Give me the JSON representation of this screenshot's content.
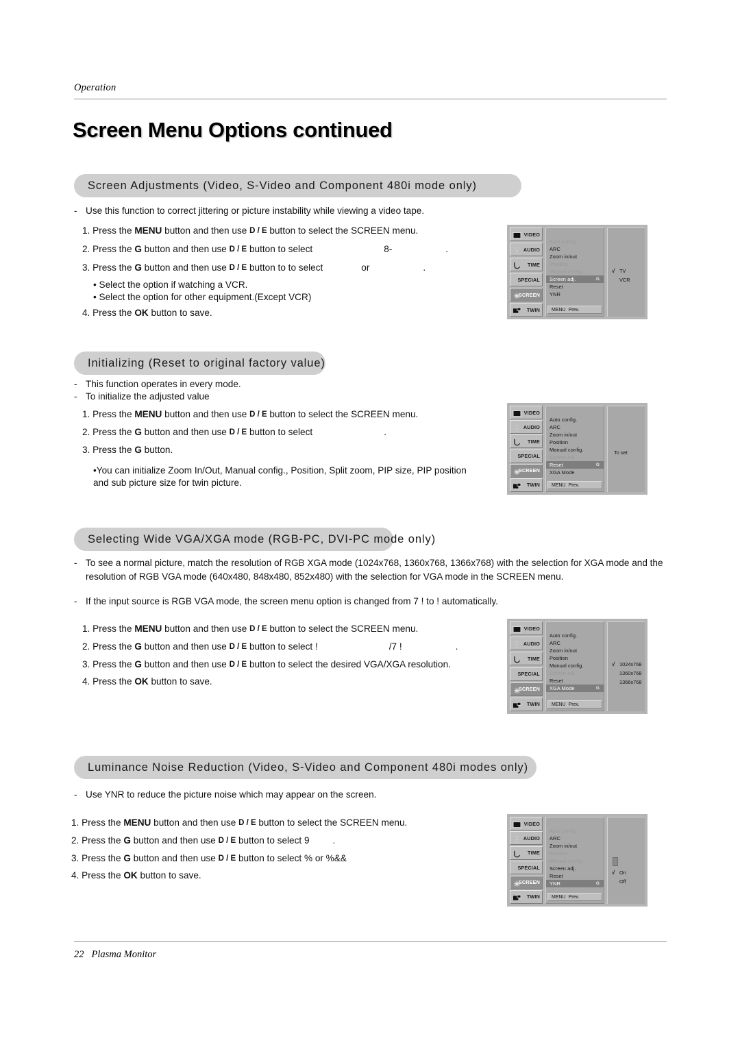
{
  "header": {
    "running_head": "Operation",
    "title": "Screen Menu Options continued"
  },
  "footer": {
    "page_number": "22",
    "product": "Plasma Monitor"
  },
  "sections": [
    {
      "id": "screen-adjustments",
      "heading": "Screen Adjustments (Video, S-Video and Component 480i mode only)",
      "intro": [
        "Use this function to correct jittering or picture instability while viewing a video tape."
      ],
      "steps": [
        {
          "num": "1.",
          "pre": "Press the ",
          "bold": "MENU",
          "mid": " button and then use ",
          "keys": "D / E",
          "post": " button to select the SCREEN menu."
        },
        {
          "num": "2.",
          "pre": "Press the ",
          "bold": "G",
          "mid": " button and then use ",
          "keys": "D / E",
          "post": " button to select",
          "trail": "8-"
        },
        {
          "num": "3.",
          "pre": "Press the ",
          "bold": "G",
          "mid": " button and then use ",
          "keys": "D / E",
          "post": " button to to select",
          "trail": "or"
        }
      ],
      "bullets": [
        "Select the        option if watching a VCR.",
        "Select the        option for other equipment.(Except VCR)"
      ],
      "final_step": {
        "num": "4.",
        "pre": "Press the ",
        "bold": "OK",
        "post": " button to save."
      }
    },
    {
      "id": "initializing",
      "heading": "Initializing (Reset to original factory value)",
      "intro": [
        "This function operates in every mode.",
        "To initialize the adjusted value"
      ],
      "steps": [
        {
          "num": "1.",
          "pre": "Press the ",
          "bold": "MENU",
          "mid": " button and then use ",
          "keys": "D / E",
          "post": " button to select the SCREEN menu."
        },
        {
          "num": "2.",
          "pre": "Press the ",
          "bold": "G",
          "mid": " button and then use ",
          "keys": "D / E",
          "post": " button to select",
          "trail": "."
        },
        {
          "num": "3.",
          "pre": "Press the ",
          "bold": "G",
          "mid": " button.",
          "keys": "",
          "post": ""
        }
      ],
      "bullets": [
        "You can initialize Zoom In/Out, Manual config., Position, Split zoom, PIP size, PIP position and sub picture size for twin picture."
      ]
    },
    {
      "id": "wide-vga-xga",
      "heading": "Selecting Wide VGA/XGA mode (RGB-PC, DVI-PC mode only)",
      "intro": [
        "To see a normal picture, match the resolution of RGB XGA mode (1024x768, 1360x768, 1366x768) with the selection for XGA mode and the resolution of RGB VGA mode (640x480, 848x480, 852x480) with the selection for VGA mode in the SCREEN menu.",
        "If the input source is RGB VGA mode, the screen menu option is changed from 7 !                to  !                automatically."
      ],
      "steps": [
        {
          "num": "1.",
          "pre": "Press the ",
          "bold": "MENU",
          "mid": " button and then use ",
          "keys": "D / E",
          "post": " button to select the SCREEN menu."
        },
        {
          "num": "2.",
          "pre": "Press the ",
          "bold": "G",
          "mid": " button and then use ",
          "keys": "D / E",
          "post": " button to select  !",
          "trail": "/7 !"
        },
        {
          "num": "3.",
          "pre": "Press the ",
          "bold": "G",
          "mid": " button and then use ",
          "keys": "D / E",
          "post": " button to select the desired VGA/XGA resolution."
        }
      ],
      "final_step": {
        "num": "4.",
        "pre": "Press the ",
        "bold": "OK",
        "post": " button to save."
      }
    },
    {
      "id": "luminance-noise-reduction",
      "heading": "Luminance Noise Reduction (Video, S-Video and Component 480i modes only)",
      "intro": [
        "Use YNR to reduce the picture noise which may appear on the screen."
      ],
      "steps": [
        {
          "num": "1.",
          "pre": "Press the ",
          "bold": "MENU",
          "mid": " button and then use ",
          "keys": "D / E",
          "post": " button to select the SCREEN menu."
        },
        {
          "num": "2.",
          "pre": "Press the ",
          "bold": "G",
          "mid": " button and then use ",
          "keys": "D / E",
          "post": " button to select 9",
          "trail": "."
        },
        {
          "num": "3.",
          "pre": "Press the ",
          "bold": "G",
          "mid": " button and then use ",
          "keys": "D / E",
          "post": " button to select %   or %&&"
        }
      ],
      "final_step": {
        "num": "4.",
        "pre": "Press the ",
        "bold": "OK",
        "post": " button to save."
      }
    }
  ],
  "osd_common": {
    "tabs": [
      {
        "label": "VIDEO",
        "icon": "monitor-icon"
      },
      {
        "label": "AUDIO",
        "icon": "speaker-icon"
      },
      {
        "label": "TIME",
        "icon": "clock-icon"
      },
      {
        "label": "SPECIAL",
        "icon": "none"
      },
      {
        "label": "SCREEN",
        "icon": "screen-icon"
      },
      {
        "label": "TWIN",
        "icon": "twin-icon"
      }
    ],
    "active_tab": "SCREEN",
    "footer_menu": "MENU",
    "footer_prev": "Prev.",
    "arrow_glyph": "G",
    "check_glyph": "√"
  },
  "osd_panels": [
    {
      "id": "osd-screen-adj",
      "items": [
        {
          "label": "Auto config.",
          "state": "dim"
        },
        {
          "label": "ARC",
          "state": "normal"
        },
        {
          "label": "Zoom in/out",
          "state": "normal"
        },
        {
          "label": "Position",
          "state": "dim"
        },
        {
          "label": "Manual config.",
          "state": "dim"
        },
        {
          "label": "Screen adj.",
          "state": "selected"
        },
        {
          "label": "Reset",
          "state": "normal"
        },
        {
          "label": "YNR",
          "state": "normal"
        }
      ],
      "options": [
        {
          "label": "TV",
          "checked": true
        },
        {
          "label": "VCR",
          "checked": false
        }
      ]
    },
    {
      "id": "osd-reset",
      "items": [
        {
          "label": "Auto config.",
          "state": "normal"
        },
        {
          "label": "ARC",
          "state": "normal"
        },
        {
          "label": "Zoom in/out",
          "state": "normal"
        },
        {
          "label": "Position",
          "state": "normal"
        },
        {
          "label": "Manual config.",
          "state": "normal"
        },
        {
          "label": "Screen adj.",
          "state": "dim"
        },
        {
          "label": "Reset",
          "state": "selected"
        },
        {
          "label": "XGA Mode",
          "state": "normal"
        }
      ],
      "to_set_label": "To set",
      "options": []
    },
    {
      "id": "osd-xga-mode",
      "items": [
        {
          "label": "Auto config.",
          "state": "normal"
        },
        {
          "label": "ARC",
          "state": "normal"
        },
        {
          "label": "Zoom in/out",
          "state": "normal"
        },
        {
          "label": "Position",
          "state": "normal"
        },
        {
          "label": "Manual config.",
          "state": "normal"
        },
        {
          "label": "Screen adj.",
          "state": "dim"
        },
        {
          "label": "Reset",
          "state": "normal"
        },
        {
          "label": "XGA Mode",
          "state": "selected"
        }
      ],
      "options": [
        {
          "label": "1024x768",
          "checked": true
        },
        {
          "label": "1360x768",
          "checked": false
        },
        {
          "label": "1366x768",
          "checked": false
        }
      ]
    },
    {
      "id": "osd-ynr",
      "items": [
        {
          "label": "Auto config.",
          "state": "dim"
        },
        {
          "label": "ARC",
          "state": "normal"
        },
        {
          "label": "Zoom in/out",
          "state": "normal"
        },
        {
          "label": "Position",
          "state": "dim"
        },
        {
          "label": "Manual config.",
          "state": "dim"
        },
        {
          "label": "Screen adj.",
          "state": "normal"
        },
        {
          "label": "Reset",
          "state": "normal"
        },
        {
          "label": "YNR",
          "state": "selected"
        }
      ],
      "options": [
        {
          "label": "On",
          "checked": true
        },
        {
          "label": "Off",
          "checked": false
        }
      ]
    }
  ],
  "colors": {
    "pill_bg": "#cfcfcf",
    "osd_bg": "#b4b4b4",
    "osd_panel": "#a8a8a8",
    "osd_selected": "#7e7e7e",
    "rule": "#8d8d8d"
  }
}
